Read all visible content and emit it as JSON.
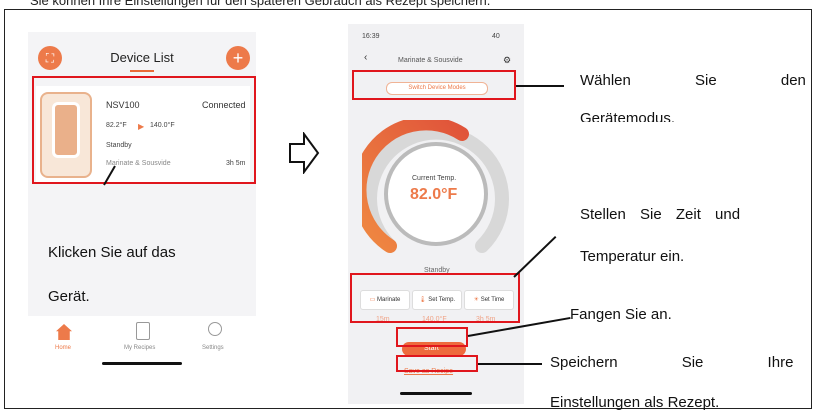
{
  "top_caption": "Sie können Ihre Einstellungen für den späteren Gebrauch als Rezept speichern.",
  "left_phone": {
    "title": "Device List",
    "device": {
      "name": "NSV100",
      "status": "Connected",
      "current_temp": "82.2°F",
      "target_temp": "140.0°F",
      "state": "Standby",
      "mode": "Marinate & Sousvide",
      "time": "3h 5m"
    },
    "tabs": [
      "Home",
      "My Recipes",
      "Settings"
    ]
  },
  "right_phone": {
    "status_time": "16:39",
    "status_battery": "40",
    "nav_title": "Marinate & Sousvide",
    "switch_label": "Switch Device Modes",
    "gauge_label": "Current Temp.",
    "gauge_value": "82.0°F",
    "state": "Standby",
    "buttons": [
      "Marinate",
      "Set Temp.",
      "Set Time"
    ],
    "values": [
      "15m",
      "140.0°F",
      "3h 5m"
    ],
    "start_label": "Start",
    "save_label": "Save as Recipe"
  },
  "annotations": {
    "click_device_1": "Klicken Sie auf das",
    "click_device_2": "Gerät.",
    "select_mode_1": "Wählen Sie den",
    "select_mode_2": "Gerätemodus.",
    "set_time_1": "Stellen Sie Zeit und",
    "set_time_2": "Temperatur ein.",
    "start": "Fangen Sie an.",
    "save_1": "Speichern Sie Ihre",
    "save_2": "Einstellungen als Rezept."
  },
  "colors": {
    "accent": "#ed7a4a",
    "highlight": "#e0161d"
  }
}
